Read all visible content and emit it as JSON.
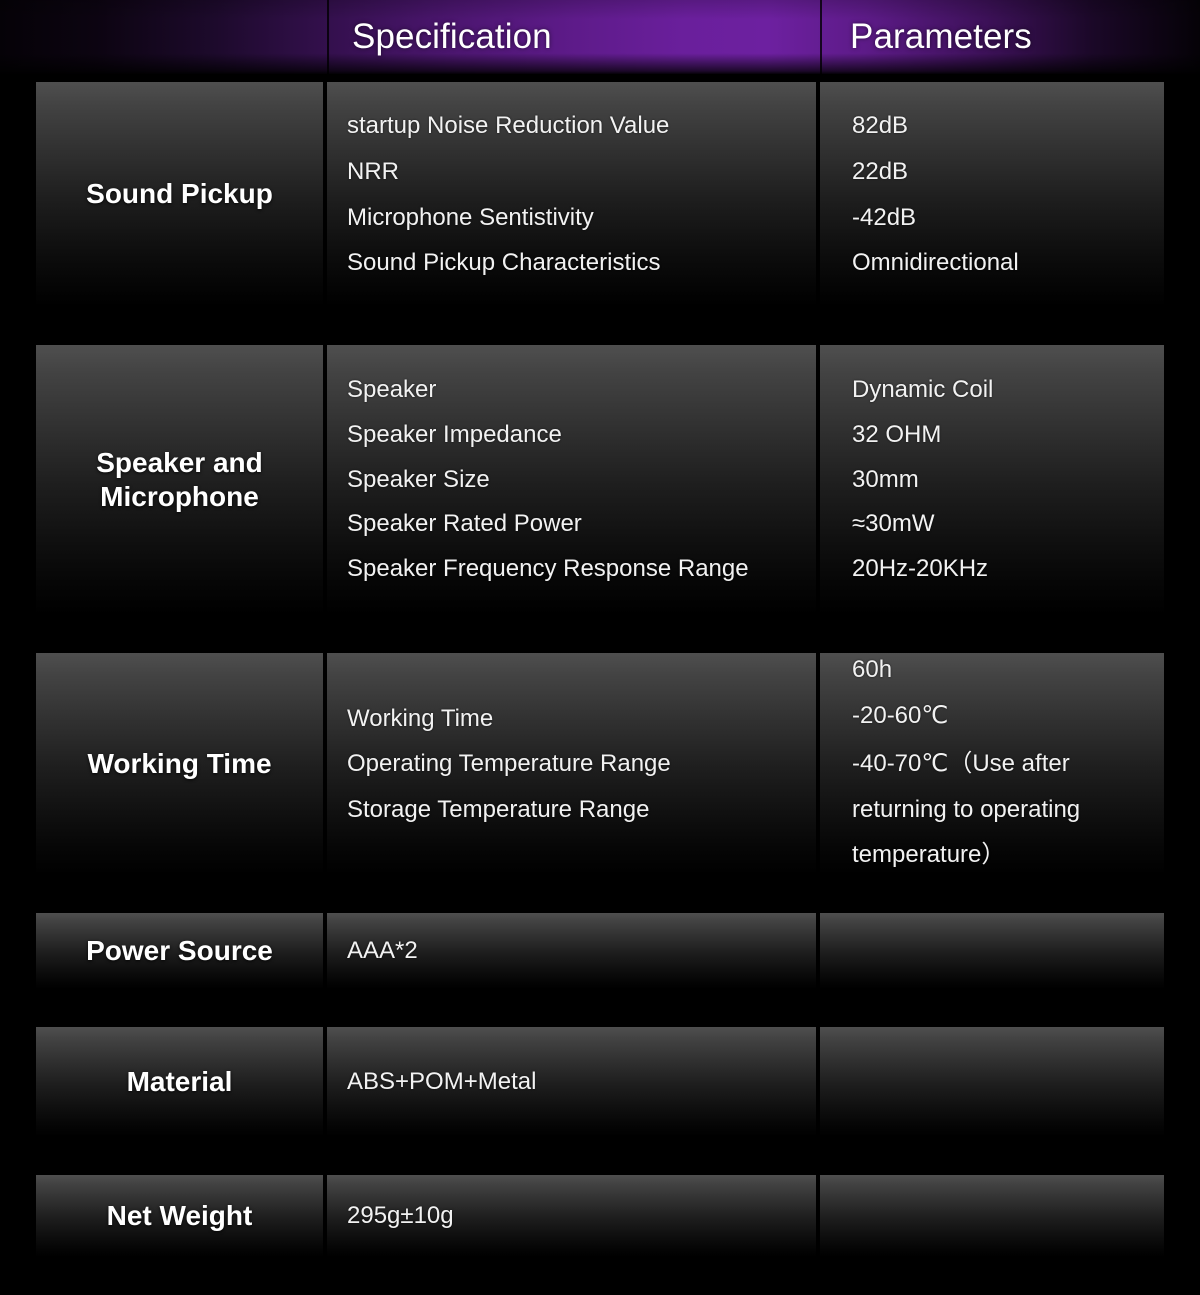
{
  "header": {
    "label_column": "",
    "spec_column": "Specification",
    "param_column": "Parameters",
    "gradient_accent": "#6d20a0"
  },
  "theme": {
    "background": "#000000",
    "cell_top": "#4f4f4f",
    "cell_bottom": "#000000",
    "text": "#f2f2f2",
    "label_text": "#ffffff"
  },
  "rows": [
    {
      "label": "Sound Pickup",
      "specs": [
        "startup Noise Reduction Value",
        "NRR",
        "Microphone Sentistivity",
        "Sound Pickup Characteristics"
      ],
      "params": [
        "82dB",
        "22dB",
        "-42dB",
        "Omnidirectional"
      ]
    },
    {
      "label": "Speaker\nand\nMicrophone",
      "specs": [
        "Speaker",
        "Speaker Impedance",
        "Speaker Size",
        "Speaker Rated Power",
        "Speaker Frequency Response Range"
      ],
      "params": [
        "Dynamic Coil",
        "32 OHM",
        "30mm",
        "≈30mW",
        "20Hz-20KHz"
      ]
    },
    {
      "label": "Working Time",
      "specs": [
        "Working Time",
        "Operating Temperature Range",
        "Storage Temperature Range"
      ],
      "params": [
        "60h",
        "-20-60℃",
        "-40-70℃（Use after returning to operating temperature）"
      ]
    },
    {
      "label": "Power Source",
      "specs": [
        "AAA*2"
      ],
      "params": []
    },
    {
      "label": "Material",
      "specs": [
        "ABS+POM+Metal"
      ],
      "params": []
    },
    {
      "label": "Net Weight",
      "specs": [
        "295g±10g"
      ],
      "params": []
    }
  ]
}
